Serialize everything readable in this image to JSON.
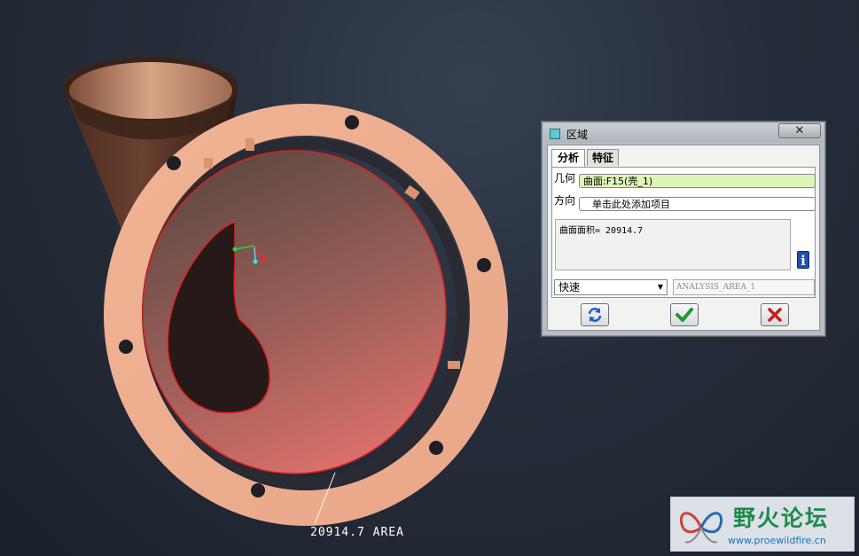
{
  "viewport": {
    "annotation": "20914.7 AREA"
  },
  "dialog": {
    "title": "区域",
    "close_symbol": "✕",
    "tabs": [
      {
        "label": "分析",
        "active": true
      },
      {
        "label": "特征",
        "active": false
      }
    ],
    "geometry_label": "几何",
    "geometry_value": "曲面:F15(壳_1)",
    "direction_label": "方向",
    "direction_value": "单击此处添加项目",
    "result_text": "曲面面积= 20914.7",
    "mode_select": "快速",
    "analysis_name": "ANALYSIS_AREA_1",
    "icons": {
      "title": "dialog-square-icon",
      "info": "info-icon",
      "repeat": "repeat-arrows-icon",
      "ok": "check-icon",
      "cancel": "cross-icon"
    }
  },
  "watermark": {
    "chinese": "野火论坛",
    "url": "www.proewildfire.cn"
  },
  "colors": {
    "flange": "#efb08f",
    "surface_highlight": "#e05050",
    "ok_green": "#1f9a2f",
    "cancel_red": "#c81e1e",
    "info_blue": "#1f4fb3"
  }
}
